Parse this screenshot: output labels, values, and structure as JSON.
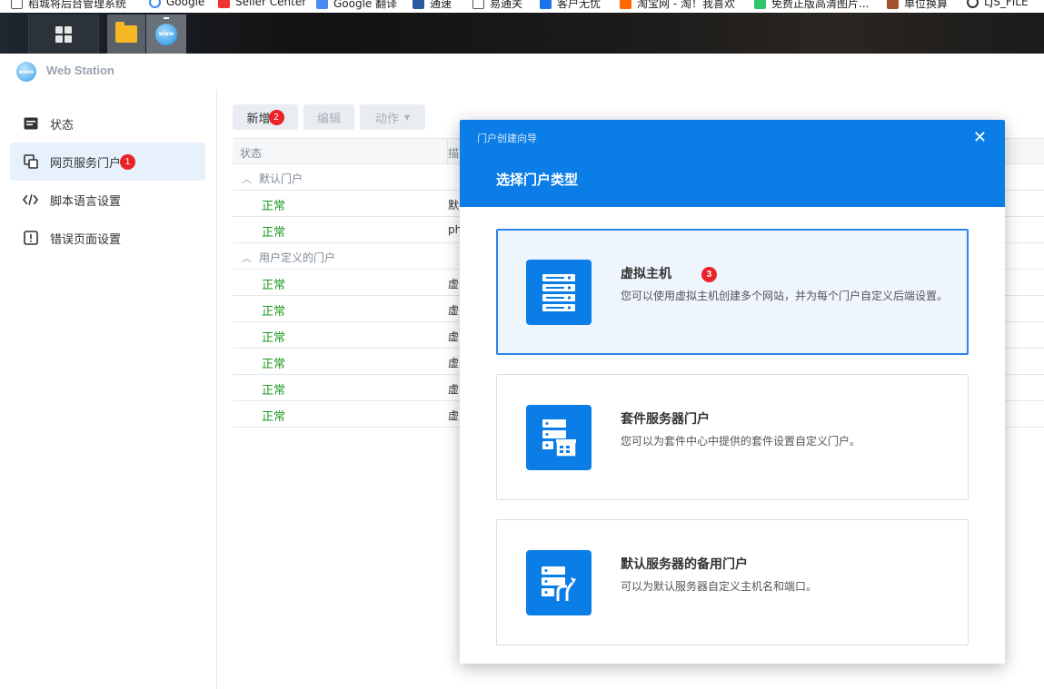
{
  "bookmarks": [
    "稻城将后台管理系统",
    "Google",
    "Seller Center",
    "Google 翻译",
    "通速",
    "易通关",
    "客户无忧",
    "淘宝网 - 淘！我喜欢",
    "免费正版高清图片...",
    "单位换算",
    "LJS_FILE"
  ],
  "app": {
    "title": "Web Station"
  },
  "sidebar": {
    "items": [
      {
        "label": "状态"
      },
      {
        "label": "网页服务门户",
        "badge": "1"
      },
      {
        "label": "脚本语言设置"
      },
      {
        "label": "错误页面设置"
      }
    ]
  },
  "toolbar": {
    "add_label": "新增",
    "add_badge": "2",
    "edit_label": "编辑",
    "action_label": "动作"
  },
  "table": {
    "headers": [
      "状态",
      "描"
    ],
    "groups": [
      {
        "label": "默认门户",
        "rows": [
          {
            "status": "正常",
            "col2": "默"
          },
          {
            "status": "正常",
            "col2": "ph"
          }
        ]
      },
      {
        "label": "用户定义的门户",
        "rows": [
          {
            "status": "正常",
            "col2": "虚"
          },
          {
            "status": "正常",
            "col2": "虚"
          },
          {
            "status": "正常",
            "col2": "虚"
          },
          {
            "status": "正常",
            "col2": "虚"
          },
          {
            "status": "正常",
            "col2": "虚"
          },
          {
            "status": "正常",
            "col2": "虚"
          }
        ]
      }
    ]
  },
  "dialog": {
    "window_title": "门户创建向导",
    "heading": "选择门户类型",
    "options": [
      {
        "title": "虚拟主机",
        "badge": "3",
        "desc": "您可以使用虚拟主机创建多个网站，并为每个门户自定义后端设置。",
        "selected": true,
        "icon": "server-stack-icon"
      },
      {
        "title": "套件服务器门户",
        "desc": "您可以为套件中心中提供的套件设置自定义门户。",
        "selected": false,
        "icon": "package-server-icon"
      },
      {
        "title": "默认服务器的备用门户",
        "desc": "可以为默认服务器自定义主机名和端口。",
        "selected": false,
        "icon": "alternate-server-icon"
      }
    ]
  },
  "colors": {
    "accent": "#0b7de7",
    "status_ok": "#1c9a20",
    "badge": "#e8232a"
  }
}
